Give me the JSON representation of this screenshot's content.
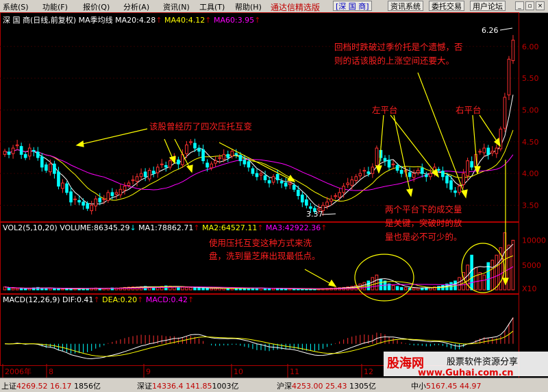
{
  "menu": [
    "系统(S)",
    "功能(F)",
    "报价(Q)",
    "分析(A)",
    "资讯(N)",
    "工具(T)",
    "帮助(H)"
  ],
  "app_title": "通达信精选版",
  "stock_button": "[深 国 商]",
  "toolbar_buttons": [
    "资讯系统",
    "委托交易",
    "用户论坛"
  ],
  "window_controls": [
    "_",
    "▫",
    "×"
  ],
  "price_header": {
    "name": "深 国 商(日线,前复权)",
    "ma_label": "MA季均线",
    "ma20": "MA20:4.28",
    "ma40": "MA40:4.12",
    "ma60": "MA60:3.95"
  },
  "volume_header": {
    "label": "VOL2(5,10,20)",
    "volume": "VOLUME:86345.29",
    "ma1": "MA1:78862.71",
    "ma2": "MA2:64527.11",
    "ma3": "MA3:42922.36"
  },
  "macd_header": {
    "label": "MACD(12,26,9)",
    "dif": "DIF:0.41",
    "dea": "DEA:0.20",
    "macd": "MACD:0.42"
  },
  "price_axis": [
    "6.00",
    "5.50",
    "5.00",
    "4.50",
    "4.00",
    "3.50"
  ],
  "volume_axis": [
    "10000",
    "5000"
  ],
  "volume_unit": "X10",
  "time_axis": [
    "2006年",
    "8",
    "9",
    "10",
    "11",
    "12"
  ],
  "markers": {
    "high": "6.26",
    "low": "3.37"
  },
  "annotations": {
    "top_right_1": "回档时跌破过季价托是个遗憾，否",
    "top_right_2": "则的话该股的上涨空间还要大。",
    "left_platform": "左平台",
    "right_platform": "右平台",
    "four_times": "该股曾经历了四次压托互变",
    "volume_note_1": "两个平台下的成交量",
    "volume_note_2": "是关键，突破时的放",
    "volume_note_3": "量也是必不可少的。",
    "wash_note_1": "使用压托互变这种方式来洗",
    "wash_note_2": "盘，洗到量芝麻出现最低点。"
  },
  "watermark": {
    "brand": "股海网",
    "slogan": "股票软件资源分享",
    "url": "www.Guhai.com.cn"
  },
  "statusbar": [
    {
      "name": "上证",
      "price": "4269.52",
      "change": "16.17",
      "amount": "1856亿"
    },
    {
      "name": "深证",
      "price": "14336.4",
      "change": "141.85",
      "amount": "1003亿"
    },
    {
      "name": "沪深",
      "price": "4253.00",
      "change": "25.43",
      "amount": "1305亿"
    },
    {
      "name": "中小",
      "price": "5167.45",
      "change": "44.97",
      "amount": ""
    }
  ],
  "colors": {
    "up": "#ff3030",
    "down": "#00ffff",
    "ma20": "#ffffff",
    "ma40": "#ffff00",
    "ma60": "#ff00ff",
    "annotation": "#ff2020",
    "arrow": "#ffff00",
    "axis": "#c00000"
  },
  "chart_data": {
    "type": "candlestick",
    "price_range": [
      3.3,
      6.3
    ],
    "closes": [
      4.35,
      4.3,
      4.4,
      4.45,
      4.3,
      4.25,
      4.4,
      4.35,
      4.25,
      4.1,
      4.05,
      4.15,
      4.0,
      3.8,
      3.85,
      3.7,
      3.55,
      3.6,
      3.55,
      3.5,
      3.45,
      3.5,
      3.6,
      3.55,
      3.6,
      3.7,
      3.65,
      3.7,
      3.75,
      3.8,
      3.85,
      3.9,
      3.95,
      4.0,
      3.95,
      4.05,
      4.0,
      4.1,
      4.15,
      4.1,
      4.2,
      4.25,
      4.15,
      4.3,
      4.45,
      4.5,
      4.4,
      4.35,
      4.2,
      4.1,
      4.15,
      4.2,
      4.25,
      4.3,
      4.25,
      4.35,
      4.3,
      4.2,
      4.15,
      4.1,
      4.0,
      3.95,
      4.0,
      3.9,
      3.85,
      3.95,
      3.9,
      3.85,
      3.8,
      3.85,
      3.75,
      3.65,
      3.55,
      3.5,
      3.45,
      3.4,
      3.45,
      3.5,
      3.55,
      3.6,
      3.65,
      3.7,
      3.8,
      3.85,
      3.9,
      3.95,
      4.0,
      4.05,
      4.0,
      4.1,
      4.4,
      4.25,
      4.2,
      4.1,
      4.15,
      4.05,
      4.0,
      4.05,
      3.95,
      4.0,
      4.05,
      4.0,
      3.95,
      4.0,
      4.1,
      4.05,
      3.95,
      3.85,
      3.75,
      3.7,
      3.8,
      4.0,
      4.2,
      4.1,
      4.3,
      4.35,
      4.4,
      4.3,
      4.35,
      4.4,
      4.7,
      5.2,
      5.8,
      6.1
    ],
    "ma_periods": [
      20,
      40,
      60
    ],
    "volume_range": [
      0,
      12000
    ],
    "volume": [
      600,
      400,
      350,
      300,
      280,
      250,
      300,
      420,
      500,
      380,
      350,
      300,
      320,
      250,
      200,
      180,
      220,
      260,
      300,
      280,
      320,
      350,
      380,
      330,
      300,
      350,
      400,
      380,
      420,
      500,
      550,
      600,
      580,
      650,
      700,
      600,
      550,
      620,
      700,
      800,
      750,
      650,
      600,
      550,
      500,
      480,
      450,
      400,
      380,
      350,
      300,
      320,
      350,
      330,
      300,
      280,
      300,
      320,
      350,
      380,
      400,
      380,
      350,
      330,
      300,
      280,
      260,
      240,
      220,
      200,
      180,
      160,
      150,
      140,
      160,
      180,
      200,
      250,
      300,
      350,
      400,
      450,
      500,
      600,
      700,
      900,
      1200,
      1500,
      1800,
      2500,
      3000,
      2200,
      1800,
      1200,
      900,
      700,
      500,
      450,
      400,
      380,
      350,
      400,
      450,
      500,
      600,
      700,
      900,
      1200,
      1500,
      1800,
      2500,
      3500,
      5000,
      7000,
      4500,
      3500,
      3000,
      5500,
      6000,
      7000,
      8500,
      11500,
      9000,
      10000
    ],
    "macd_range": [
      -0.3,
      0.6
    ],
    "time_labels": [
      "2006年",
      "8",
      "9",
      "10",
      "11",
      "12"
    ]
  }
}
